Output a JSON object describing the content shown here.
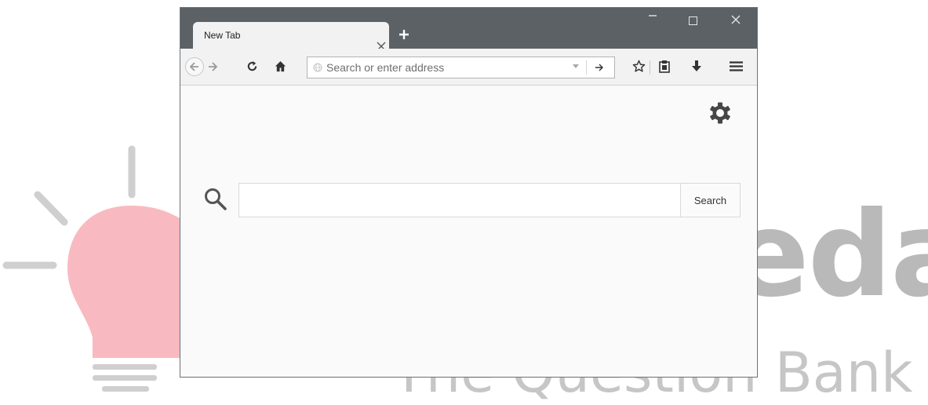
{
  "tab": {
    "title": "New Tab"
  },
  "address_bar": {
    "placeholder": "Search or enter address",
    "value": ""
  },
  "search": {
    "button_label": "Search",
    "value": ""
  },
  "watermark": {
    "brand": "eda",
    "subtitle": "The Question Bank"
  },
  "colors": {
    "titlebar": "#5b6165",
    "toolbar": "#f2f2f2",
    "content_background": "#fafafa",
    "watermark_bulb": "#f5a3ab"
  },
  "icons": [
    "back-arrow-icon",
    "forward-arrow-icon",
    "reload-icon",
    "home-icon",
    "globe-icon",
    "dropdown-icon",
    "go-arrow-icon",
    "bookmark-star-icon",
    "clipboard-icon",
    "download-icon",
    "hamburger-menu-icon",
    "gear-icon",
    "search-icon",
    "new-tab-plus-icon",
    "close-icon",
    "minimize-icon",
    "maximize-icon"
  ]
}
